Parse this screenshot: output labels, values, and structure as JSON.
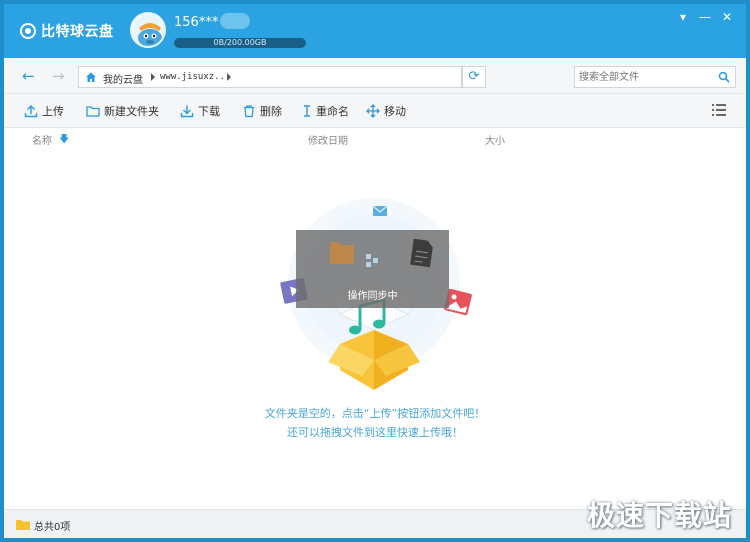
{
  "app": {
    "logo_text": "比特球云盘",
    "username": "156***",
    "quota_text": "0B/200.00GB",
    "quota_used": 0,
    "accent": "#2ba3e3",
    "window_controls": {
      "menu": "▾",
      "minimize": "—",
      "close": "✕"
    }
  },
  "nav": {
    "back_icon": "arrow-left-icon",
    "forward_icon": "arrow-right-icon",
    "breadcrumb": [
      "我的云盘",
      "www.jisuxz..."
    ],
    "refresh_icon": "refresh-icon",
    "search_placeholder": "搜索全部文件"
  },
  "toolbar": {
    "upload": "上传",
    "new_folder": "新建文件夹",
    "download": "下载",
    "delete": "删除",
    "rename": "重命名",
    "move": "移动"
  },
  "columns": {
    "name": "名称",
    "modified": "修改日期",
    "size": "大小"
  },
  "empty_state": {
    "sync_label": "操作同步中",
    "line1": "文件夹是空的，点击“上传”按钮添加文件吧！",
    "line2": "还可以拖拽文件到这里快速上传哦！"
  },
  "status": {
    "total": "总共0项"
  },
  "watermark": "极速下载站"
}
